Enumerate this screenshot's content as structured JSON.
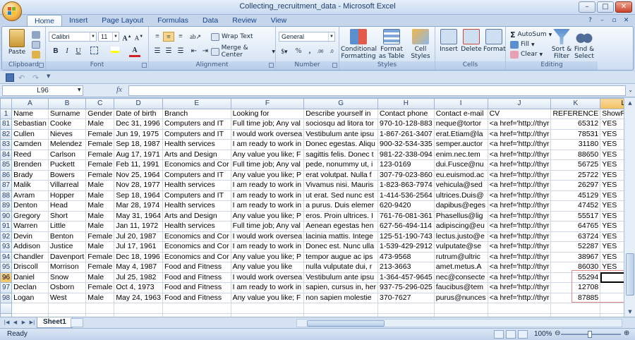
{
  "window": {
    "title": "Collecting_recruitment_data - Microsoft Excel"
  },
  "tabs": [
    "Home",
    "Insert",
    "Page Layout",
    "Formulas",
    "Data",
    "Review",
    "View"
  ],
  "active_tab": "Home",
  "ribbon": {
    "clipboard": {
      "label": "Clipboard",
      "paste": "Paste"
    },
    "font": {
      "label": "Font",
      "name": "Calibri",
      "size": "11"
    },
    "alignment": {
      "label": "Alignment",
      "wrap": "Wrap Text",
      "merge": "Merge & Center"
    },
    "number": {
      "label": "Number",
      "format": "General"
    },
    "styles": {
      "label": "Styles",
      "conditional": "Conditional Formatting",
      "format_table": "Format as Table",
      "cell_styles": "Cell Styles"
    },
    "cells": {
      "label": "Cells",
      "insert": "Insert",
      "delete": "Delete",
      "format": "Format"
    },
    "editing": {
      "label": "Editing",
      "autosum": "AutoSum",
      "fill": "Fill",
      "clear": "Clear",
      "sort": "Sort & Filter",
      "find": "Find & Select"
    }
  },
  "formula_bar": {
    "name_box": "L96",
    "fx": "fx",
    "content": ""
  },
  "columns": [
    "A",
    "B",
    "C",
    "D",
    "E",
    "F",
    "G",
    "H",
    "I",
    "J",
    "K",
    "L"
  ],
  "header_row": {
    "num": "1",
    "cells": [
      "Name",
      "Surname",
      "Gender",
      "Date of birth",
      "Branch",
      "Looking for",
      "Describe yourself in",
      "Contact phone",
      "Contact e-mail",
      "CV",
      "REFERENCE",
      "ShowRecord"
    ]
  },
  "rows": [
    {
      "num": "81",
      "cells": [
        "Sebastian",
        "Cooke",
        "Male",
        "Dec 31, 1996",
        "Computers and IT",
        "Full time job; Any val",
        "sociosqu ad litora tor",
        "970-10-128-883",
        "neque@tortor",
        "<a href='http://thyr",
        "65312",
        "YES"
      ]
    },
    {
      "num": "82",
      "cells": [
        "Cullen",
        "Nieves",
        "Female",
        "Jun 19, 1975",
        "Computers and IT",
        "I would work oversea",
        "Vestibulum ante ipsu",
        "1-867-261-3407",
        "erat.Etiam@la",
        "<a href='http://thyr",
        "78531",
        "YES"
      ]
    },
    {
      "num": "83",
      "cells": [
        "Camden",
        "Melendez",
        "Female",
        "Sep 18, 1987",
        "Health services",
        "I am ready to work in",
        "Donec egestas. Aliqu",
        "900-32-534-335",
        "semper.auctor",
        "<a href='http://thyr",
        "31180",
        "YES"
      ]
    },
    {
      "num": "84",
      "cells": [
        "Reed",
        "Carlson",
        "Female",
        "Aug 17, 1971",
        "Arts and Design",
        "Any value you like; F",
        "sagittis felis. Donec t",
        "981-22-338-094",
        "enim.nec.tem",
        "<a href='http://thyr",
        "88650",
        "YES"
      ]
    },
    {
      "num": "85",
      "cells": [
        "Brenden",
        "Puckett",
        "Female",
        "Feb 11, 1991",
        "Economics and Cor",
        "Full time job; Any val",
        "pede, nonummy ut, i",
        "123-0169",
        "dui.Fusce@nu",
        "<a href='http://thyr",
        "56725",
        "YES"
      ]
    },
    {
      "num": "86",
      "cells": [
        "Brady",
        "Bowers",
        "Female",
        "Nov 25, 1964",
        "Computers and IT",
        "Any value you like; P",
        "erat volutpat. Nulla f",
        "307-79-023-860",
        "eu.euismod.ac",
        "<a href='http://thyr",
        "25722",
        "YES"
      ]
    },
    {
      "num": "87",
      "cells": [
        "Malik",
        "Villarreal",
        "Male",
        "Nov 28, 1977",
        "Health services",
        "I am ready to work in",
        "Vivamus nisi. Mauris",
        "1-823-863-7974",
        "vehicula@sed",
        "<a href='http://thyr",
        "26297",
        "YES"
      ]
    },
    {
      "num": "88",
      "cells": [
        "Avram",
        "Hopper",
        "Male",
        "Sep 18, 1964",
        "Computers and IT",
        "I am ready to work in",
        "ut erat. Sed nunc est",
        "1-414-536-2564",
        "ultrices.Duis@",
        "<a href='http://thyr",
        "45129",
        "YES"
      ]
    },
    {
      "num": "89",
      "cells": [
        "Denton",
        "Head",
        "Male",
        "Mar 28, 1974",
        "Health services",
        "I am ready to work in",
        "a purus. Duis elemer",
        "620-9420",
        "dapibus@eges",
        "<a href='http://thyr",
        "47452",
        "YES"
      ]
    },
    {
      "num": "90",
      "cells": [
        "Gregory",
        "Short",
        "Male",
        "May 31, 1964",
        "Arts and Design",
        "Any value you like; P",
        "eros. Proin ultrices. I",
        "761-76-081-361",
        "Phasellus@lig",
        "<a href='http://thyr",
        "55517",
        "YES"
      ]
    },
    {
      "num": "91",
      "cells": [
        "Warren",
        "Little",
        "Male",
        "Jan 11, 1972",
        "Health services",
        "Full time job; Any val",
        "Aenean egestas hen",
        "627-56-494-114",
        "adipiscing@eu",
        "<a href='http://thyr",
        "64765",
        "YES"
      ]
    },
    {
      "num": "92",
      "cells": [
        "Devin",
        "Benton",
        "Female",
        "Jul 20, 1987",
        "Economics and Cor",
        "I would work oversea",
        "lacinia mattis. Intege",
        "125-51-190-743",
        "lectus.justo@e",
        "<a href='http://thyr",
        "63724",
        "YES"
      ]
    },
    {
      "num": "93",
      "cells": [
        "Addison",
        "Justice",
        "Male",
        "Jul 17, 1961",
        "Economics and Cor",
        "I am ready to work in",
        "Donec est. Nunc ulla",
        "1-539-429-2912",
        "vulputate@se",
        "<a href='http://thyr",
        "52287",
        "YES"
      ]
    },
    {
      "num": "94",
      "cells": [
        "Chandler",
        "Davenport",
        "Female",
        "Dec 18, 1996",
        "Economics and Cor",
        "Any value you like; P",
        "tempor augue ac ips",
        "473-9568",
        "rutrum@ultric",
        "<a href='http://thyr",
        "38967",
        "YES"
      ]
    },
    {
      "num": "95",
      "cells": [
        "Driscoll",
        "Morrison",
        "Female",
        "May 4, 1987",
        "Food and Fitness",
        "Any value you like",
        "nulla vulputate dui, r",
        "213-3663",
        "amet.metus.A",
        "<a href='http://thyr",
        "86030",
        "YES"
      ]
    },
    {
      "num": "96",
      "cells": [
        "Daniel",
        "Snow",
        "Male",
        "Jul 25, 1982",
        "Food and Fitness",
        "I would work oversea",
        "Vestibulum ante ipsu",
        "1-364-457-9645",
        "nec@consecte",
        "<a href='http://thyr",
        "55294",
        ""
      ]
    },
    {
      "num": "97",
      "cells": [
        "Declan",
        "Osborn",
        "Female",
        "Oct 4, 1973",
        "Food and Fitness",
        "I am ready to work in",
        "sapien, cursus in, her",
        "937-75-296-025",
        "faucibus@tem",
        "<a href='http://thyr",
        "12708",
        ""
      ]
    },
    {
      "num": "98",
      "cells": [
        "Logan",
        "West",
        "Male",
        "May 24, 1963",
        "Food and Fitness",
        "Any value you like; F",
        "non sapien molestie",
        "370-7627",
        "purus@nunces",
        "<a href='http://thyr",
        "87885",
        ""
      ]
    }
  ],
  "empty_rows": [
    "",
    ""
  ],
  "sheet": {
    "name": "Sheet1"
  },
  "status": {
    "text": "Ready",
    "zoom": "100%"
  }
}
